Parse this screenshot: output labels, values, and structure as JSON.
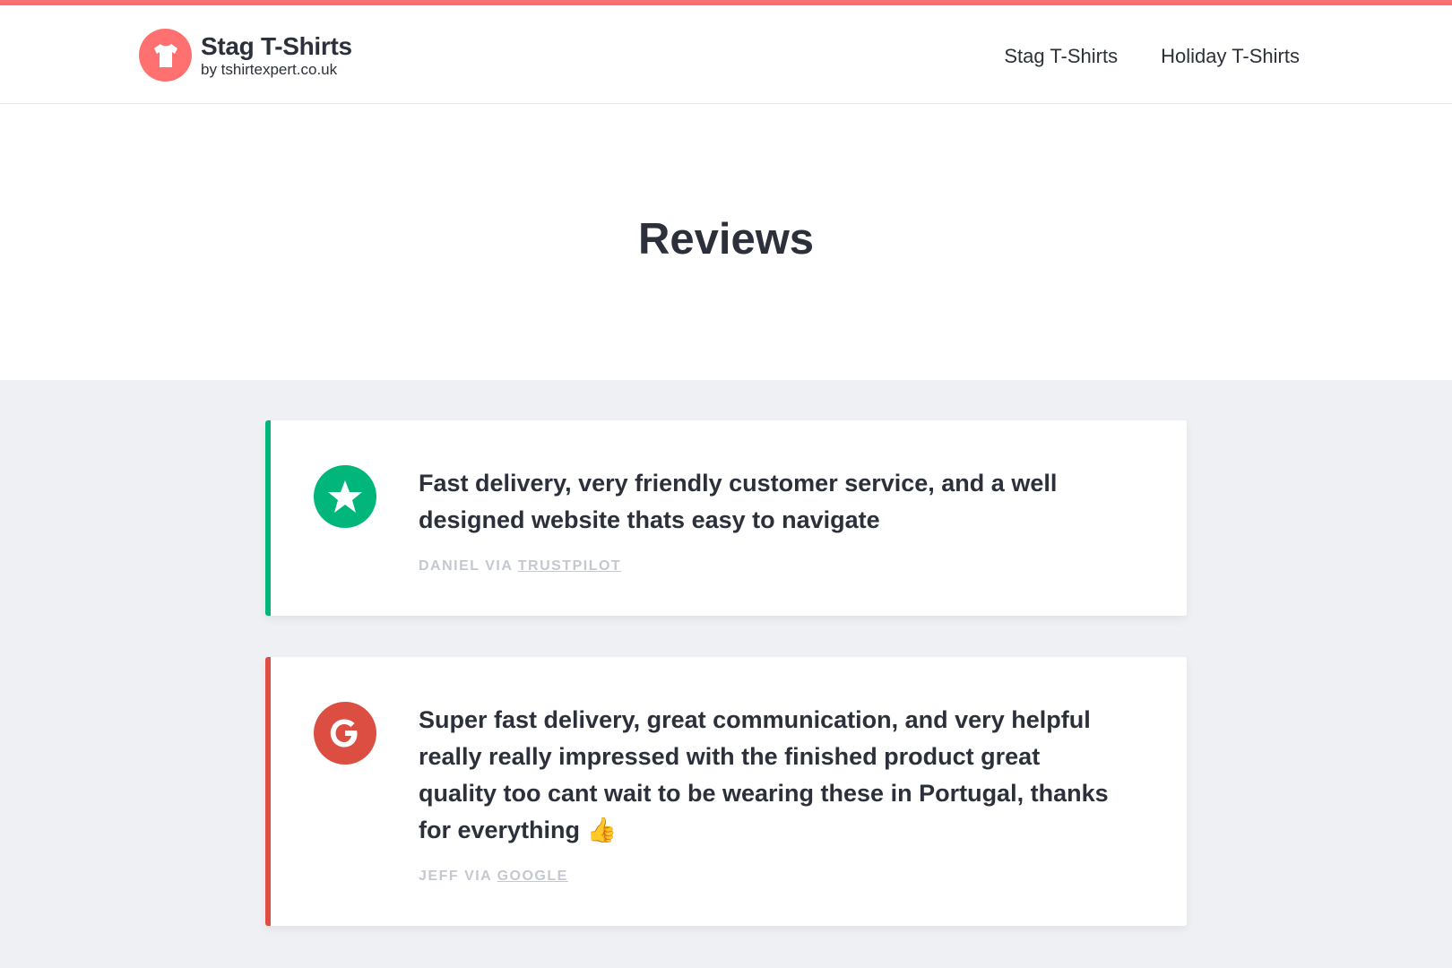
{
  "header": {
    "brand_name": "Stag T-Shirts",
    "brand_sub": "by tshirtexpert.co.uk",
    "nav": [
      {
        "label": "Stag T-Shirts"
      },
      {
        "label": "Holiday T-Shirts"
      }
    ]
  },
  "hero": {
    "title": "Reviews"
  },
  "reviews": [
    {
      "quote": "Fast delivery, very friendly customer service, and a well designed website thats easy to navigate",
      "author": "Daniel via",
      "source": "Trustpilot",
      "icon": "trustpilot-star-icon",
      "accent": "#00b67a"
    },
    {
      "quote": "Super fast delivery, great communication, and very helpful really really impressed with the finished product great quality too cant wait to be wearing these in Portugal, thanks for everything 👍",
      "author": "Jeff via",
      "source": "Google",
      "icon": "google-g-icon",
      "accent": "#dc4e41"
    }
  ],
  "colors": {
    "brand": "#ff7070",
    "text": "#2b303b",
    "muted": "#c4c8d0",
    "section_bg": "#eef0f3"
  }
}
